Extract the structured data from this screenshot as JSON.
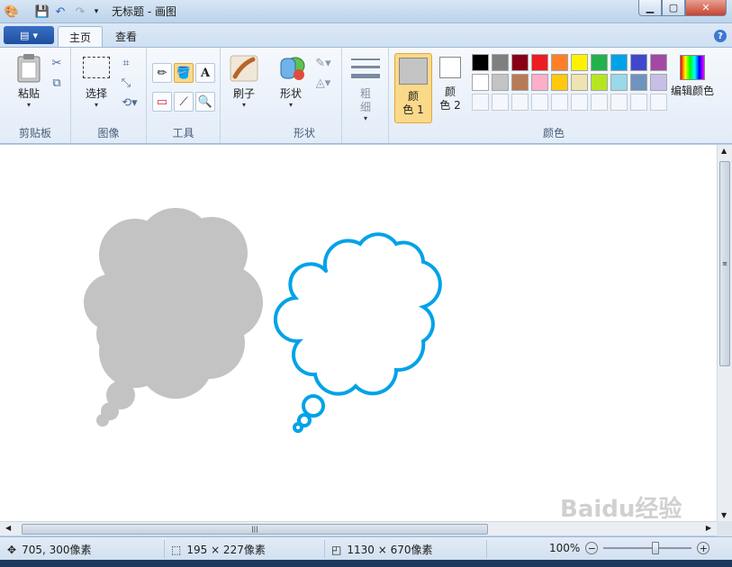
{
  "window": {
    "title": "无标题 - 画图"
  },
  "tabs": [
    {
      "label": "主页"
    },
    {
      "label": "查看"
    }
  ],
  "ribbon": {
    "clipboard": {
      "paste": "粘贴",
      "group": "剪贴板"
    },
    "image": {
      "select": "选择",
      "group": "图像"
    },
    "tools": {
      "group": "工具"
    },
    "brushes": {
      "label": "刷子"
    },
    "shapes": {
      "label": "形状",
      "group": "形状"
    },
    "size": {
      "line1": "粗",
      "line2": "细"
    },
    "colors": {
      "color1_line1": "颜",
      "color1_line2": "色 1",
      "color2_line1": "颜",
      "color2_line2": "色 2",
      "edit": "编辑颜色",
      "group": "颜色",
      "color1": "#c3c3c3",
      "color2": "#ffffff",
      "palette_row1": [
        "#000000",
        "#7f7f7f",
        "#880015",
        "#ed1c24",
        "#ff7f27",
        "#fff200",
        "#22b14c",
        "#00a2e8",
        "#3f48cc",
        "#a349a4"
      ],
      "palette_row2": [
        "#ffffff",
        "#c3c3c3",
        "#b97a57",
        "#ffaec9",
        "#ffc90e",
        "#efe4b0",
        "#b5e61d",
        "#99d9ea",
        "#7092be",
        "#c8bfe7"
      ]
    }
  },
  "canvas": {
    "shape1_fill": "#c3c3c3",
    "shape2_stroke": "#00a2e8"
  },
  "status": {
    "cursor": "705, 300像素",
    "selection": "195 × 227像素",
    "size": "1130 × 670像素",
    "zoom": "100%"
  },
  "watermark": "Baidu经验"
}
